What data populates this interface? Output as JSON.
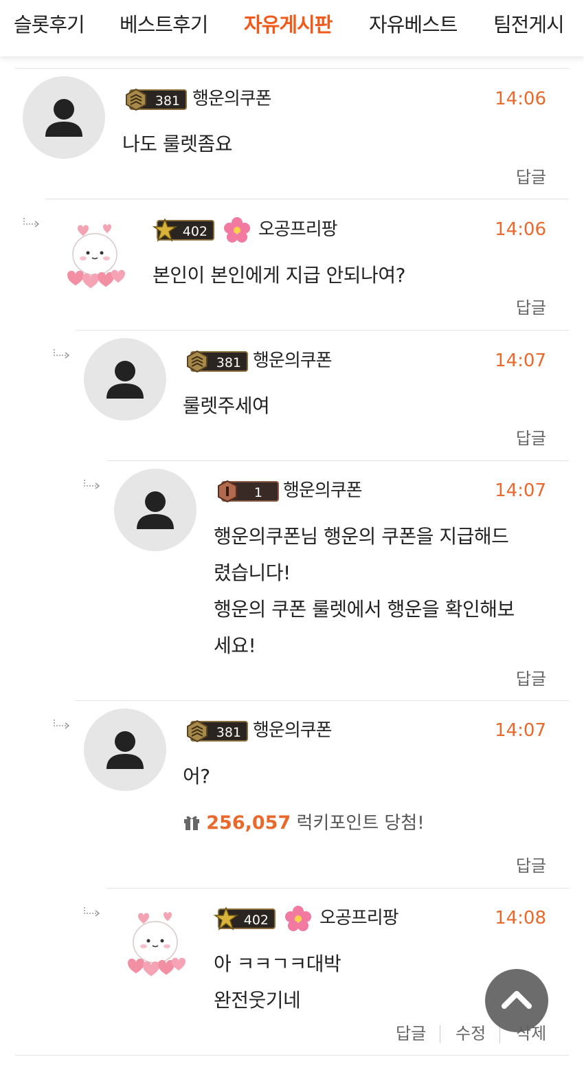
{
  "nav": {
    "tabs": [
      {
        "label": "슬롯후기",
        "active": false
      },
      {
        "label": "베스트후기",
        "active": false
      },
      {
        "label": "자유게시판",
        "active": true
      },
      {
        "label": "자유베스트",
        "active": false
      },
      {
        "label": "팀전게시",
        "active": false
      }
    ],
    "active_color": "#f05a1a"
  },
  "comments": [
    {
      "level": "381",
      "nickname": "행운의쿠폰",
      "time": "14:06",
      "content": "나도 룰렛좀요",
      "reply_label": "답글"
    },
    {
      "level": "402",
      "nickname": "오공프리팡",
      "time": "14:06",
      "content": "본인이 본인에게 지급 안되나여?",
      "reply_label": "답글"
    },
    {
      "level": "381",
      "nickname": "행운의쿠폰",
      "time": "14:07",
      "content": "룰렛주세여",
      "reply_label": "답글"
    },
    {
      "level": "1",
      "nickname": "행운의쿠폰",
      "time": "14:07",
      "content_lines": [
        "행운의쿠폰님 행운의 쿠폰을 지급해드",
        "렸습니다!",
        "행운의 쿠폰 룰렛에서 행운을 확인해보",
        "세요!"
      ],
      "reply_label": "답글"
    },
    {
      "level": "381",
      "nickname": "행운의쿠폰",
      "time": "14:07",
      "content": "어?",
      "point_amount": "256,057",
      "point_text": "럭키포인트 당첨!",
      "reply_label": "답글"
    },
    {
      "level": "402",
      "nickname": "오공프리팡",
      "time": "14:08",
      "content_lines": [
        "아 ㅋㅋㄱㅋ대박",
        "완전웃기네"
      ],
      "reply_label": "답글",
      "edit_label": "수정",
      "delete_label": "삭제"
    }
  ],
  "colors": {
    "time": "#e8692b",
    "point": "#e8692b",
    "avatar_bg": "#e6e6e6"
  },
  "icons": {
    "default_avatar": "person-silhouette-icon",
    "character_avatar": "white-blob-with-hearts-icon",
    "reply_arrow": "reply-arrow-icon",
    "gift": "gift-icon",
    "flower": "pink-flower-icon",
    "scroll_top": "chevron-up-icon"
  }
}
